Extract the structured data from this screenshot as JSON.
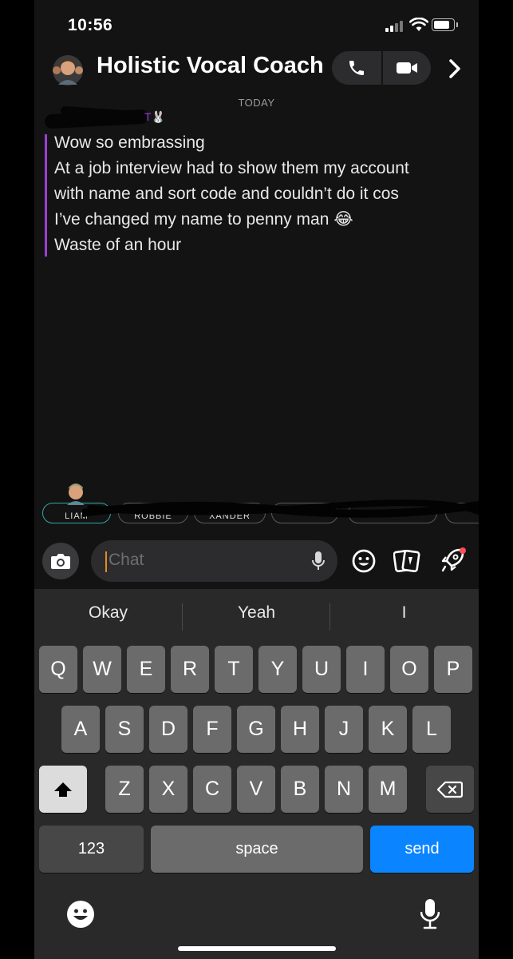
{
  "status_bar": {
    "time": "10:56"
  },
  "header": {
    "title": "Holistic Vocal Coach"
  },
  "conversation": {
    "date_label": "TODAY",
    "sender_suffix": "T🐰",
    "message_lines": [
      "Wow so embrassing",
      "At a job interview had to show them my account",
      "with name and sort code and couldn’t do it cos",
      "I’ve changed my name to penny man 😂",
      "Waste of an hour"
    ]
  },
  "friend_chips": [
    "LIAM",
    "ROBBIE",
    "XANDER"
  ],
  "chat_input": {
    "placeholder": "Chat"
  },
  "suggestions": [
    "Okay",
    "Yeah",
    "I"
  ],
  "keyboard": {
    "row1": [
      "Q",
      "W",
      "E",
      "R",
      "T",
      "Y",
      "U",
      "I",
      "O",
      "P"
    ],
    "row2": [
      "A",
      "S",
      "D",
      "F",
      "G",
      "H",
      "J",
      "K",
      "L"
    ],
    "row3": [
      "Z",
      "X",
      "C",
      "V",
      "B",
      "N",
      "M"
    ],
    "numbers_label": "123",
    "space_label": "space",
    "send_label": "send"
  },
  "colors": {
    "background": "#131313",
    "message_accent": "#9b3fd1",
    "send_key": "#0a84ff",
    "caret": "#e58b1f",
    "active_chip": "#32a7a5"
  },
  "icons": [
    "phone-icon",
    "video-icon",
    "chevron-right-icon",
    "camera-icon",
    "mic-icon",
    "emoji-icon",
    "cards-icon",
    "rocket-icon",
    "shift-icon",
    "backspace-icon"
  ]
}
